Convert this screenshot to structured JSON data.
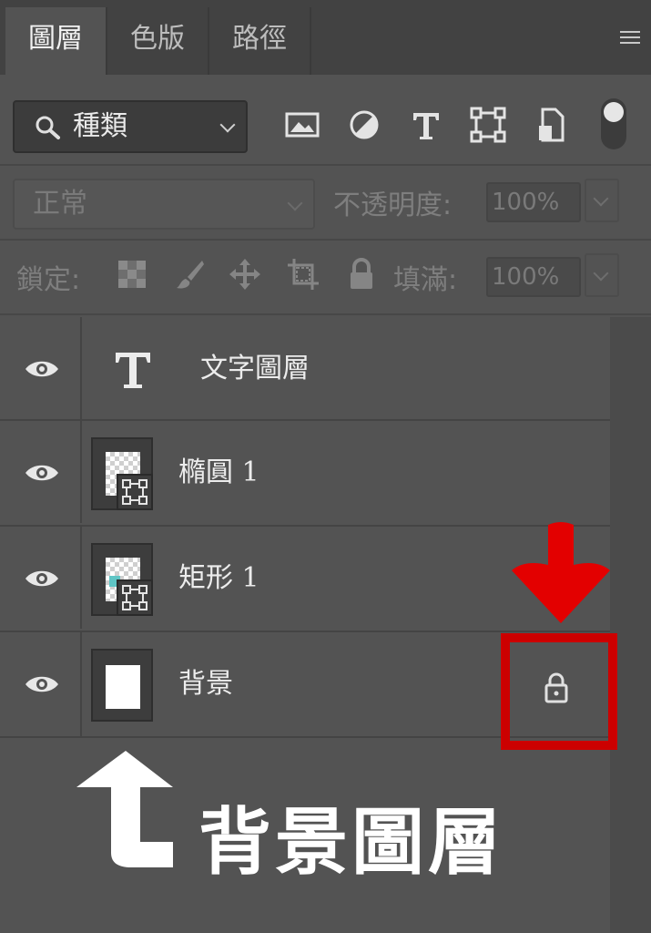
{
  "tabs": [
    {
      "label": "圖層",
      "active": true
    },
    {
      "label": "色版",
      "active": false
    },
    {
      "label": "路徑",
      "active": false
    }
  ],
  "filter": {
    "kind_label": "種類",
    "icons": [
      "image-filter-icon",
      "adjustment-filter-icon",
      "type-filter-icon",
      "shape-filter-icon",
      "smart-object-filter-icon"
    ]
  },
  "blend": {
    "mode": "正常",
    "opacity_label": "不透明度:",
    "opacity_value": "100%"
  },
  "lock": {
    "label": "鎖定:",
    "fill_label": "填滿:",
    "fill_value": "100%",
    "icons": [
      "lock-transparent-icon",
      "lock-image-icon",
      "lock-position-icon",
      "lock-artboard-icon",
      "lock-all-icon"
    ]
  },
  "layers": [
    {
      "name": "文字圖層",
      "type": "text",
      "visible": true
    },
    {
      "name": "橢圓 1",
      "type": "shape",
      "swatch": "#f2c300",
      "visible": true
    },
    {
      "name": "矩形 1",
      "type": "shape",
      "swatch": "#5fc5c5",
      "visible": true
    },
    {
      "name": "背景",
      "type": "background",
      "locked": true,
      "visible": true
    }
  ],
  "annotation": {
    "caption": "背景圖層",
    "highlight_color": "#cc0000",
    "arrow_color": "#e30000"
  }
}
